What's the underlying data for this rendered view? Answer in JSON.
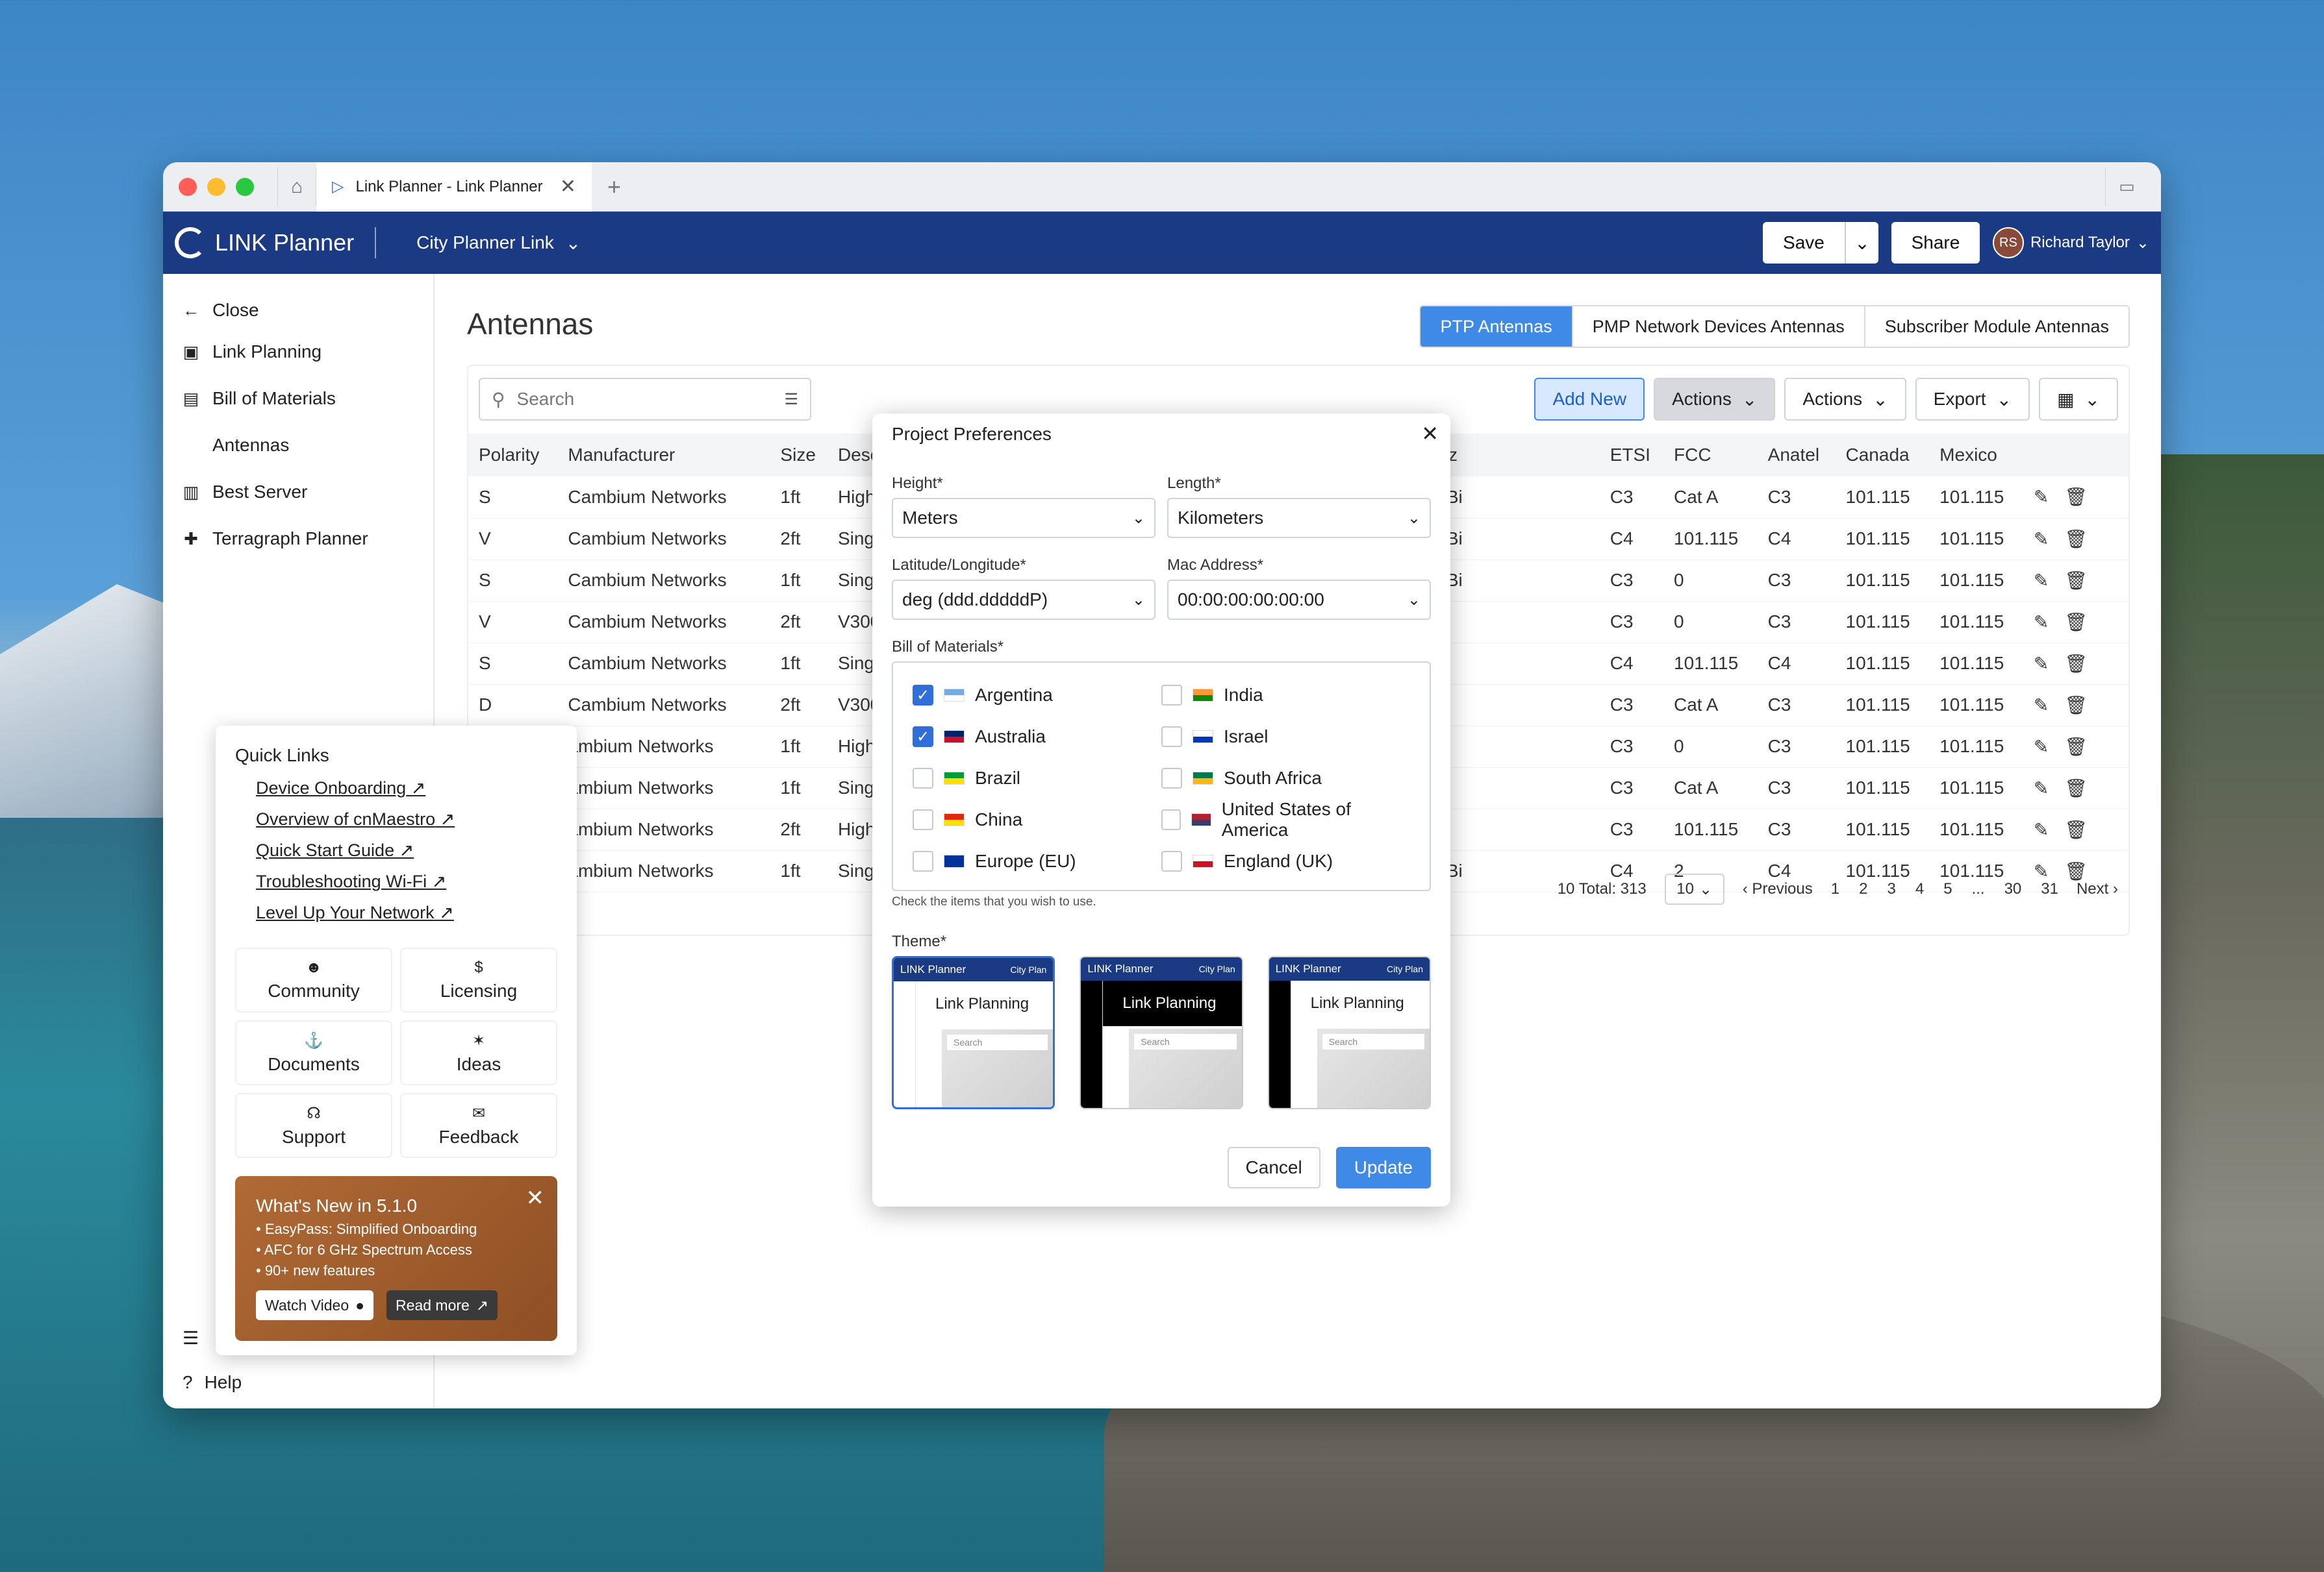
{
  "window": {
    "tab_title": "Link Planner - Link Planner"
  },
  "app": {
    "brand": "LINK Planner",
    "project": "City Planner Link",
    "save": "Save",
    "share": "Share",
    "user_initials": "RS",
    "user_name": "Richard Taylor"
  },
  "sidebar": {
    "items": [
      {
        "label": "Close",
        "icon": "arrow-left-icon",
        "glyph": "←"
      },
      {
        "label": "Link Planning",
        "icon": "map-icon",
        "glyph": "▣"
      },
      {
        "label": "Bill of Materials",
        "icon": "bom-icon",
        "glyph": "▤"
      },
      {
        "label": "Antennas",
        "icon": "antenna-icon",
        "glyph": ""
      },
      {
        "label": "Best Server",
        "icon": "server-icon",
        "glyph": "▥"
      },
      {
        "label": "Terragraph Planner",
        "icon": "puzzle-icon",
        "glyph": "✚"
      }
    ],
    "help": "Help"
  },
  "page": {
    "title": "Antennas",
    "tabs": [
      "PTP Antennas",
      "PMP Network Devices Antennas",
      "Subscriber Module Antennas"
    ],
    "search_placeholder": "Search",
    "add_new": "Add New",
    "actions1": "Actions",
    "actions2": "Actions",
    "export": "Export"
  },
  "table": {
    "headers": [
      "Polarity",
      "Manufacturer",
      "Size",
      "Descript",
      "60 GHz",
      "ETSI",
      "FCC",
      "Anatel",
      "Canada",
      "Mexico"
    ],
    "rows": [
      [
        "S",
        "Cambium Networks",
        "1ft",
        "High Ga",
        "22.5 dBi",
        "C3",
        "Cat A",
        "C3",
        "101.115",
        "101.115"
      ],
      [
        "V",
        "Cambium Networks",
        "2ft",
        "Single P",
        "22.5 dBi",
        "C4",
        "101.115",
        "C4",
        "101.115",
        "101.115"
      ],
      [
        "S",
        "Cambium Networks",
        "1ft",
        "Single P",
        "44.0 dBi",
        "C3",
        "0",
        "C3",
        "101.115",
        "101.115"
      ],
      [
        "V",
        "Cambium Networks",
        "2ft",
        "V3000 S",
        "-",
        "C3",
        "0",
        "C3",
        "101.115",
        "101.115"
      ],
      [
        "S",
        "Cambium Networks",
        "1ft",
        "Single P",
        "-",
        "C4",
        "101.115",
        "C4",
        "101.115",
        "101.115"
      ],
      [
        "D",
        "Cambium Networks",
        "2ft",
        "V3000 S",
        "-",
        "C3",
        "Cat A",
        "C3",
        "101.115",
        "101.115"
      ],
      [
        "",
        "ambium Networks",
        "1ft",
        "High Ga",
        "-",
        "C3",
        "0",
        "C3",
        "101.115",
        "101.115"
      ],
      [
        "",
        "ambium Networks",
        "1ft",
        "Single P",
        "-",
        "C3",
        "Cat A",
        "C3",
        "101.115",
        "101.115"
      ],
      [
        "",
        "ambium Networks",
        "2ft",
        "High Ga",
        "-",
        "C3",
        "101.115",
        "C3",
        "101.115",
        "101.115"
      ],
      [
        "",
        "ambium Networks",
        "1ft",
        "Single P",
        "44.0 dBi",
        "C4",
        "2",
        "C4",
        "101.115",
        "101.115"
      ]
    ]
  },
  "pager": {
    "total": "10 Total: 313",
    "per_page": "10",
    "prev": "Previous",
    "pages": [
      "1",
      "2",
      "3",
      "4",
      "5",
      "...",
      "30",
      "31"
    ],
    "next": "Next"
  },
  "quick_links": {
    "title": "Quick Links",
    "links": [
      "Device Onboarding",
      "Overview of cnMaestro",
      "Quick Start Guide",
      "Troubleshooting Wi-Fi",
      "Level Up Your Network"
    ],
    "tiles": [
      {
        "label": "Community",
        "glyph": "☻"
      },
      {
        "label": "Licensing",
        "glyph": "$"
      },
      {
        "label": "Documents",
        "glyph": "⚓"
      },
      {
        "label": "Ideas",
        "glyph": "✶"
      },
      {
        "label": "Support",
        "glyph": "☊"
      },
      {
        "label": "Feedback",
        "glyph": "✉"
      }
    ],
    "news_title": "What's New in 5.1.0",
    "news_items": [
      "• EasyPass: Simplified Onboarding",
      "• AFC for 6 GHz Spectrum Access",
      "• 90+ new features"
    ],
    "watch": "Watch Video",
    "read": "Read more"
  },
  "modal": {
    "title": "Project Preferences",
    "height_label": "Height",
    "height": "Meters",
    "length_label": "Length",
    "length": "Kilometers",
    "latlon_label": "Latitude/Longitude",
    "latlon": "deg (ddd.dddddP)",
    "mac_label": "Mac Address",
    "mac": "00:00:00:00:00:00",
    "bom_label": "Bill of Materials",
    "countries": [
      {
        "name": "Argentina",
        "checked": true,
        "c1": "#74acdf",
        "c2": "#fff"
      },
      {
        "name": "India",
        "checked": false,
        "c1": "#ff9933",
        "c2": "#138808"
      },
      {
        "name": "Australia",
        "checked": true,
        "c1": "#012169",
        "c2": "#c8102e"
      },
      {
        "name": "Israel",
        "checked": false,
        "c1": "#fff",
        "c2": "#0038b8"
      },
      {
        "name": "Brazil",
        "checked": false,
        "c1": "#009c3b",
        "c2": "#ffdf00"
      },
      {
        "name": "South Africa",
        "checked": false,
        "c1": "#007a4d",
        "c2": "#ffb612"
      },
      {
        "name": "China",
        "checked": false,
        "c1": "#de2910",
        "c2": "#ffde00"
      },
      {
        "name": "United States of America",
        "checked": false,
        "c1": "#b22234",
        "c2": "#3c3b6e"
      },
      {
        "name": "Europe (EU)",
        "checked": false,
        "c1": "#003399",
        "c2": "#003399"
      },
      {
        "name": "England (UK)",
        "checked": false,
        "c1": "#fff",
        "c2": "#ce1124"
      }
    ],
    "hint": "Check the items that you wish to use.",
    "theme_label": "Theme",
    "theme_brand": "LINK Planner",
    "theme_project": "City Plan",
    "theme_page": "Link Planning",
    "theme_search": "Search",
    "cancel": "Cancel",
    "update": "Update"
  }
}
